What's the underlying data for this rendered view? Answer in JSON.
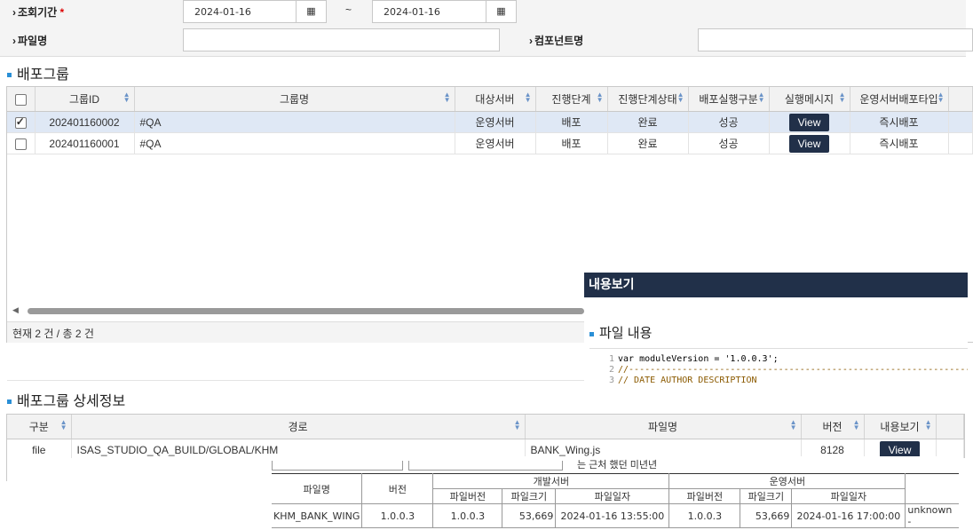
{
  "search": {
    "period_label": "조회기간",
    "required_mark": "*",
    "date_from": "2024-01-16",
    "date_sep": "~",
    "date_to": "2024-01-16",
    "filename_label": "파일명",
    "filename_value": "",
    "component_label": "컴포넌트명",
    "component_value": ""
  },
  "group_section": {
    "title": "배포그룹",
    "columns": [
      "그룹ID",
      "그룹명",
      "대상서버",
      "진행단계",
      "진행단계상태",
      "배포실행구분",
      "실행메시지",
      "운영서버배포타입"
    ],
    "rows": [
      {
        "checked": true,
        "id": "202401160002",
        "name": "#QA",
        "server": "운영서버",
        "stage": "배포",
        "status": "완료",
        "exec": "성공",
        "msg": "View",
        "type": "즉시배포"
      },
      {
        "checked": false,
        "id": "202401160001",
        "name": "#QA",
        "server": "운영서버",
        "stage": "배포",
        "status": "완료",
        "exec": "성공",
        "msg": "View",
        "type": "즉시배포"
      }
    ],
    "count_text": "현재 2 건 / 총 2 건"
  },
  "popup": {
    "title": "내용보기",
    "subtitle": "파일 내용",
    "code_lines": [
      {
        "n": "1",
        "text": "var moduleVersion = '1.0.0.3';"
      },
      {
        "n": "2",
        "text": "//-------------------------------------------------------------------------"
      },
      {
        "n": "3",
        "text": "//     DATE        AUTHOR      DESCRIPTION"
      }
    ]
  },
  "detail_section": {
    "title": "배포그룹 상세정보",
    "columns": [
      "구분",
      "경로",
      "파일명",
      "버전",
      "내용보기"
    ],
    "rows": [
      {
        "type": "file",
        "path": "ISAS_STUDIO_QA_BUILD/GLOBAL/KHM",
        "file": "BANK_Wing.js",
        "version": "8128",
        "view": "View"
      }
    ]
  },
  "file_table": {
    "h_filename": "파일명",
    "h_version": "버전",
    "h_dev": "개발서버",
    "h_prod": "운영서버",
    "h_fver": "파일버전",
    "h_fsize": "파일크기",
    "h_fdate": "파일일자",
    "row": {
      "name": "KHM_BANK_WING",
      "version": "1.0.0.3",
      "dev_ver": "1.0.0.3",
      "dev_size": "53,669",
      "dev_date": "2024-01-16 13:55:00",
      "prod_ver": "1.0.0.3",
      "prod_size": "53,669",
      "prod_date": "2024-01-16 17:00:00",
      "extra": "unknown -"
    },
    "partial_text": "는 근처 했던 미년년"
  },
  "colors": {
    "accent": "#213049",
    "bullet": "#2a8fd6",
    "required": "#dd0000"
  }
}
